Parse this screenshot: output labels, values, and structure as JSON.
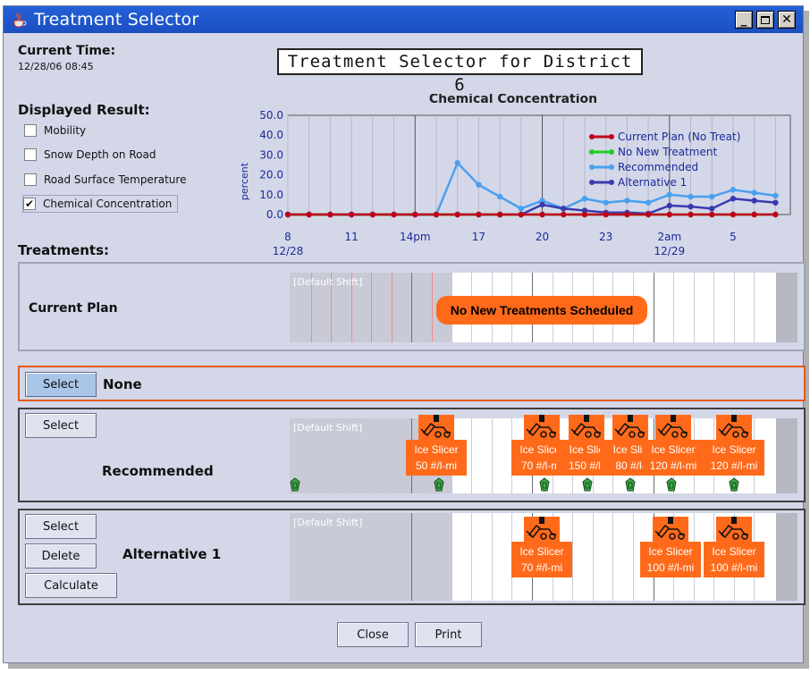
{
  "window": {
    "title": "Treatment Selector",
    "controls": [
      "_",
      "□",
      "X"
    ]
  },
  "current_time": {
    "label": "Current Time:",
    "value": "12/28/06 08:45"
  },
  "banner": "Treatment Selector for District 6",
  "displayed_result": {
    "label": "Displayed Result:",
    "options": [
      {
        "label": "Mobility",
        "checked": false
      },
      {
        "label": "Snow Depth on Road",
        "checked": false
      },
      {
        "label": "Road Surface Temperature",
        "checked": false
      },
      {
        "label": "Chemical Concentration",
        "checked": true
      }
    ]
  },
  "chart_data": {
    "type": "line",
    "title": "Chemical Concentration",
    "ylabel": "percent",
    "ylim": [
      0,
      50
    ],
    "yticks": [
      "50.0",
      "40.0",
      "30.0",
      "20.0",
      "10.0",
      "0.0"
    ],
    "xticks": [
      {
        "label": "8",
        "sub": "12/28",
        "hour": 8
      },
      {
        "label": "11",
        "sub": "",
        "hour": 11
      },
      {
        "label": "14pm",
        "sub": "",
        "hour": 14
      },
      {
        "label": "17",
        "sub": "",
        "hour": 17
      },
      {
        "label": "20",
        "sub": "",
        "hour": 20
      },
      {
        "label": "23",
        "sub": "",
        "hour": 23
      },
      {
        "label": "2am",
        "sub": "12/29",
        "hour": 26
      },
      {
        "label": "5",
        "sub": "",
        "hour": 29
      }
    ],
    "x": [
      8,
      9,
      10,
      11,
      12,
      13,
      14,
      15,
      16,
      17,
      18,
      19,
      20,
      21,
      22,
      23,
      24,
      25,
      26,
      27,
      28,
      29,
      30,
      31
    ],
    "series": [
      {
        "name": "Current Plan (No Treat)",
        "color": "#c0001a",
        "values": [
          0,
          0,
          0,
          0,
          0,
          0,
          0,
          0,
          0,
          0,
          0,
          0,
          0,
          0,
          0,
          0,
          0,
          0,
          0,
          0,
          0,
          0,
          0,
          0
        ]
      },
      {
        "name": "No New Treatment",
        "color": "#22cc22",
        "values": [
          0,
          0,
          0,
          0,
          0,
          0,
          0,
          0,
          0,
          0,
          0,
          0,
          0,
          0,
          0,
          0,
          0,
          0,
          0,
          0,
          0,
          0,
          0,
          0
        ]
      },
      {
        "name": "Recommended",
        "color": "#4aa0f0",
        "values": [
          0,
          0,
          0,
          0,
          0,
          0,
          0,
          0,
          26,
          15,
          9,
          3,
          7,
          3,
          8,
          6,
          7,
          6,
          10,
          9,
          9,
          12.5,
          11,
          9.5
        ]
      },
      {
        "name": "Alternative 1",
        "color": "#3a3ab0",
        "values": [
          0,
          0,
          0,
          0,
          0,
          0,
          0,
          0,
          0,
          0,
          0,
          0,
          5,
          3,
          2,
          1,
          1,
          0.5,
          4.5,
          4,
          3,
          8,
          7,
          6
        ]
      }
    ],
    "legend": "top-right",
    "grid": true
  },
  "treatments_label": "Treatments:",
  "current_plan": {
    "label": "Current Plan",
    "shift_label": "[Default Shift]",
    "message": "No New Treatments Scheduled"
  },
  "none_row": {
    "select_label": "Select",
    "label": "None"
  },
  "recommended": {
    "select_label": "Select",
    "label": "Recommended",
    "shift_label": "[Default Shift]",
    "treatments": [
      {
        "name": "Ice Slicer",
        "rate": "50 #/l-mi"
      },
      {
        "name": "Ice Slicer",
        "rate": "70 #/l-mi"
      },
      {
        "name": "Ice Slic",
        "rate": "150 #/l-"
      },
      {
        "name": "Ice Slic",
        "rate": "80 #/l-"
      },
      {
        "name": "Ice Slicer",
        "rate": "120 #/l-mi"
      },
      {
        "name": "Ice Slicer",
        "rate": "120 #/l-mi"
      }
    ]
  },
  "alternative": {
    "select_label": "Select",
    "delete_label": "Delete",
    "calculate_label": "Calculate",
    "label": "Alternative 1",
    "shift_label": "[Default Shift]",
    "treatments": [
      {
        "name": "Ice Slicer",
        "rate": "70 #/l-mi"
      },
      {
        "name": "Ice Slicer",
        "rate": "100 #/l-mi"
      },
      {
        "name": "Ice Slicer",
        "rate": "100 #/l-mi"
      }
    ]
  },
  "footer": {
    "close_label": "Close",
    "print_label": "Print"
  }
}
